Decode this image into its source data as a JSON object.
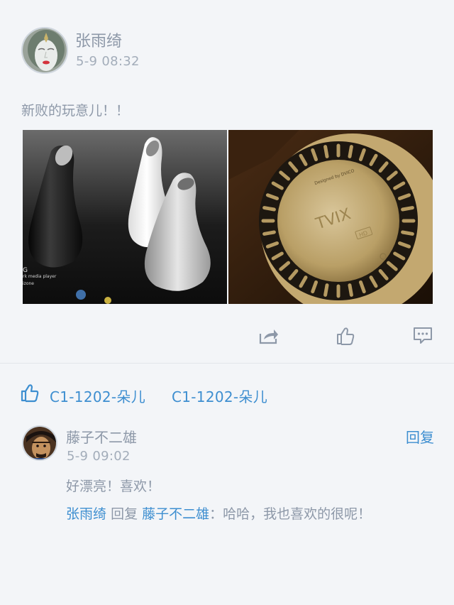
{
  "post": {
    "author": "张雨绮",
    "time": "5-9 08:32",
    "text": "新败的玩意儿！！",
    "images": [
      {
        "icon": "speaker-product-photo",
        "caption_lines": [
          "G",
          "rk media player",
          "izone"
        ]
      },
      {
        "icon": "media-player-closeup-photo",
        "brand": "TVIX",
        "sub": "HD",
        "tag": "Designed by DVICO"
      }
    ],
    "actions": [
      "share-icon",
      "like-icon",
      "comment-icon"
    ]
  },
  "likes": {
    "icon": "thumbs-up-icon",
    "users": [
      "C1-1202-朵儿",
      "C1-1202-朵儿"
    ]
  },
  "comment": {
    "author": "藤子不二雄",
    "time": "5-9 09:02",
    "reply_label": "回复",
    "text": "好漂亮！喜欢！",
    "sub_reply": {
      "from": "张雨绮",
      "verb": "回复",
      "to": "藤子不二雄",
      "text": "：哈哈，我也喜欢的很呢！"
    }
  },
  "colors": {
    "background": "#f3f5f8",
    "accent": "#3d8ed0",
    "text": "#8d98a8"
  }
}
